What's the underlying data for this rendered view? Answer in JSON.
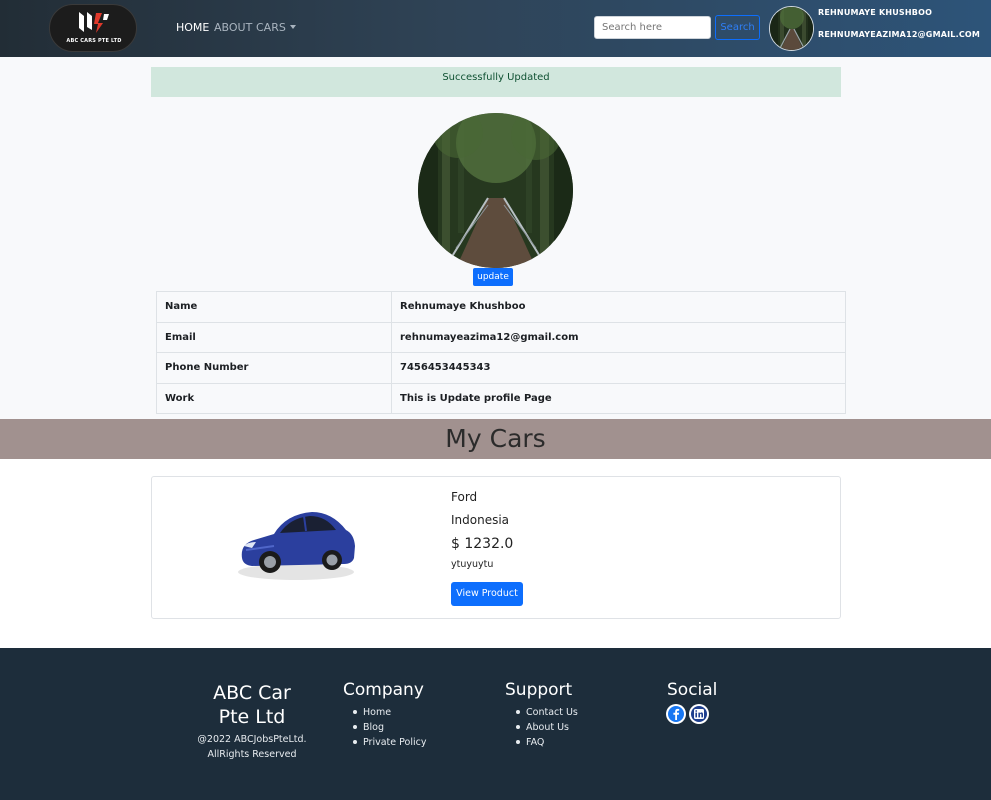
{
  "navbar": {
    "logo_text": "ABC CARS PTE LTD",
    "links": [
      {
        "label": "HOME",
        "active": true
      },
      {
        "label": "ABOUT",
        "active": false
      },
      {
        "label": "CARS",
        "active": false
      }
    ],
    "search_placeholder": "Search here",
    "search_button": "Search",
    "user_name": "REHNUMAYE KHUSHBOO",
    "user_email": "REHNUMAYEAZIMA12@GMAIL.COM"
  },
  "alert": {
    "message": "Successfully Updated",
    "color": "#d1e7dd"
  },
  "profile": {
    "update_label": "update",
    "rows": [
      {
        "label": "Name",
        "value": "Rehnumaye Khushboo"
      },
      {
        "label": "Email",
        "value": "rehnumayeazima12@gmail.com"
      },
      {
        "label": "Phone Number",
        "value": "7456453445343"
      },
      {
        "label": "Work",
        "value": "This is Update profile Page"
      }
    ]
  },
  "my_cars": {
    "title": "My Cars",
    "cars": [
      {
        "brand": "Ford",
        "country": "Indonesia",
        "price": "$ 1232.0",
        "description": "ytuyuytu",
        "button": "View Product"
      }
    ]
  },
  "footer": {
    "brand_line1": "ABC Car",
    "brand_line2": "Pte Ltd",
    "copyright": "@2022 ABCJobsPteLtd. AllRights Reserved",
    "company": {
      "title": "Company",
      "items": [
        "Home",
        "Blog",
        "Private Policy"
      ]
    },
    "support": {
      "title": "Support",
      "items": [
        "Contact Us",
        "About Us",
        "FAQ"
      ]
    },
    "social": {
      "title": "Social",
      "icons": [
        "facebook-icon",
        "linkedin-icon"
      ]
    }
  },
  "colors": {
    "primary": "#0d6efd",
    "band": "#a1918f",
    "footer": "#1d2d3b"
  }
}
